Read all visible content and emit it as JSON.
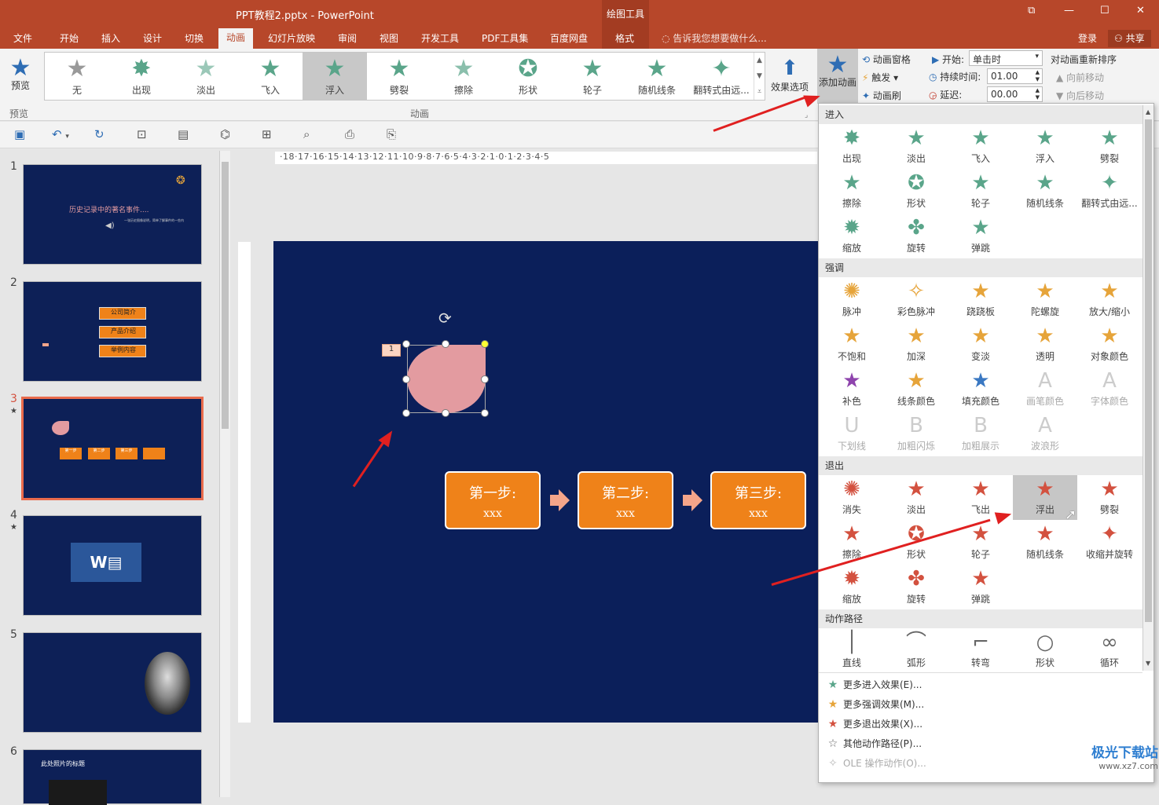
{
  "window": {
    "title": "PPT教程2.pptx - PowerPoint",
    "tool_tab_title": "绘图工具",
    "buttons": [
      "⧉",
      "—",
      "☐",
      "✕"
    ]
  },
  "tabs": [
    "文件",
    "开始",
    "插入",
    "设计",
    "切换",
    "动画",
    "幻灯片放映",
    "审阅",
    "视图",
    "开发工具",
    "PDF工具集",
    "百度网盘",
    "格式"
  ],
  "active_tab": "动画",
  "tell_me": "告诉我您想要做什么...",
  "account": {
    "login": "登录",
    "share": "共享"
  },
  "ribbon": {
    "preview_label": "预览",
    "preview_group": "预览",
    "gallery": [
      "无",
      "出现",
      "淡出",
      "飞入",
      "浮入",
      "劈裂",
      "擦除",
      "形状",
      "轮子",
      "随机线条",
      "翻转式由远..."
    ],
    "gallery_selected": "浮入",
    "gallery_group": "动画",
    "effect_options": "效果选项",
    "add_animation": "添加动画",
    "anim_pane": "动画窗格",
    "trigger": "触发",
    "anim_painter": "动画刷",
    "start_label": "开始:",
    "start_value": "单击时",
    "duration_label": "持续时间:",
    "duration_value": "01.00",
    "delay_label": "延迟:",
    "delay_value": "00.00",
    "reorder_title": "对动画重新排序",
    "move_earlier": "向前移动",
    "move_later": "向后移动"
  },
  "ruler_text": "·18·17·16·15·14·13·12·11·10·9·8·7·6·5·4·3·2·1·0·1·2·3·4·5",
  "slides": [
    {
      "num": "1",
      "title": "历史记录中的著名事件....",
      "sub": "一张历史图像说明，简单了解事件的一些内"
    },
    {
      "num": "2",
      "items": [
        "公司简介",
        "产品介绍",
        "举例内容"
      ]
    },
    {
      "num": "3",
      "star": "★",
      "steps": [
        "第一步",
        "第二步",
        "第三步"
      ]
    },
    {
      "num": "4",
      "star": "★",
      "word": "W"
    },
    {
      "num": "5"
    },
    {
      "num": "6",
      "title": "此处照片的标题"
    }
  ],
  "current_slide": {
    "anim_tag": "1",
    "steps": [
      {
        "t1": "第一步:",
        "t2": "xxx"
      },
      {
        "t1": "第二步:",
        "t2": "xxx"
      },
      {
        "t1": "第三步:",
        "t2": "xxx"
      }
    ]
  },
  "panel": {
    "sections": [
      {
        "title": "进入",
        "items": [
          "出现",
          "淡出",
          "飞入",
          "浮入",
          "劈裂",
          "擦除",
          "形状",
          "轮子",
          "随机线条",
          "翻转式由远...",
          "缩放",
          "旋转",
          "弹跳"
        ]
      },
      {
        "title": "强调",
        "items": [
          "脉冲",
          "彩色脉冲",
          "跷跷板",
          "陀螺旋",
          "放大/缩小",
          "不饱和",
          "加深",
          "变淡",
          "透明",
          "对象颜色",
          "补色",
          "线条颜色",
          "填充颜色",
          "画笔颜色",
          "字体颜色",
          "下划线",
          "加粗闪烁",
          "加粗展示",
          "波浪形"
        ],
        "disabled": [
          "画笔颜色",
          "字体颜色",
          "下划线",
          "加粗闪烁",
          "加粗展示",
          "波浪形"
        ]
      },
      {
        "title": "退出",
        "items": [
          "消失",
          "淡出",
          "飞出",
          "浮出",
          "劈裂",
          "擦除",
          "形状",
          "轮子",
          "随机线条",
          "收缩并旋转",
          "缩放",
          "旋转",
          "弹跳"
        ],
        "highlighted": "浮出"
      },
      {
        "title": "动作路径",
        "items": [
          "直线",
          "弧形",
          "转弯",
          "形状",
          "循环"
        ]
      }
    ],
    "more": [
      "更多进入效果(E)...",
      "更多强调效果(M)...",
      "更多退出效果(X)...",
      "其他动作路径(P)...",
      "OLE 操作动作(O)..."
    ]
  },
  "watermark": {
    "brand": "极光下载站",
    "url": "www.xz7.com"
  },
  "colors": {
    "title_bar": "#b7472a",
    "slide_bg": "#0b1f5a",
    "step_fill": "#ef8219",
    "teardrop": "#e39ba0",
    "enter_star": "#5aa58a",
    "emph_star": "#e6a43a",
    "exit_star": "#d3513f",
    "annotation_arrow": "#e02020"
  }
}
